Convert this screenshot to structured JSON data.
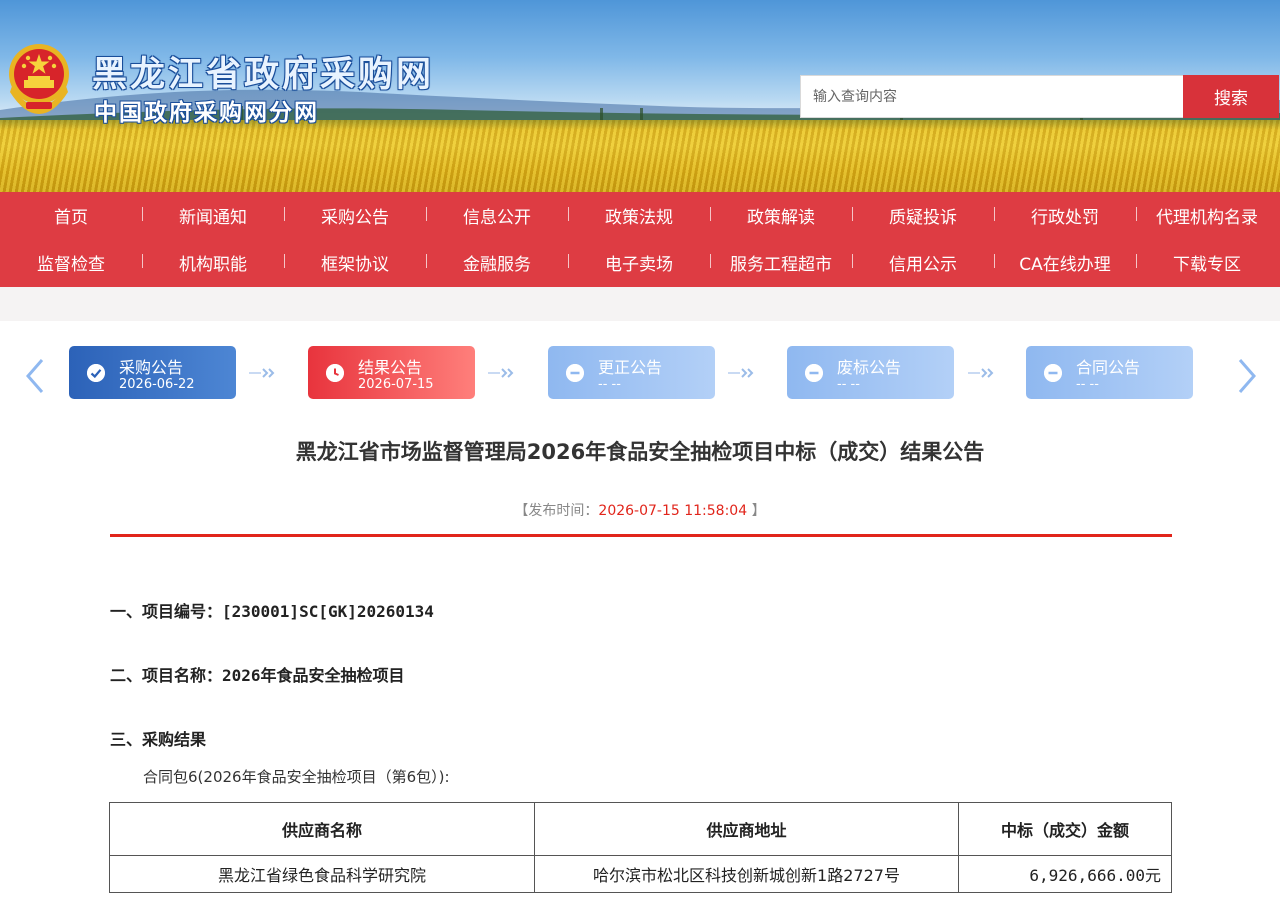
{
  "header": {
    "site_title": "黑龙江省政府采购网",
    "site_subtitle": "中国政府采购网分网",
    "search_placeholder": "输入查询内容",
    "search_button": "搜索"
  },
  "nav": {
    "row1": [
      "首页",
      "新闻通知",
      "采购公告",
      "信息公开",
      "政策法规",
      "政策解读",
      "质疑投诉",
      "行政处罚",
      "代理机构名录"
    ],
    "row2": [
      "监督检查",
      "机构职能",
      "框架协议",
      "金融服务",
      "电子卖场",
      "服务工程超市",
      "信用公示",
      "CA在线办理",
      "下载专区"
    ]
  },
  "steps": [
    {
      "label": "采购公告",
      "date": "2026-06-22",
      "icon": "check-icon",
      "state": "done"
    },
    {
      "label": "结果公告",
      "date": "2026-07-15",
      "icon": "clock-icon",
      "state": "current"
    },
    {
      "label": "更正公告",
      "date": "-- --",
      "icon": "minus-icon",
      "state": "none"
    },
    {
      "label": "废标公告",
      "date": "-- --",
      "icon": "minus-icon",
      "state": "none"
    },
    {
      "label": "合同公告",
      "date": "-- --",
      "icon": "minus-icon",
      "state": "none"
    }
  ],
  "article": {
    "title": "黑龙江省市场监督管理局2026年食品安全抽检项目中标（成交）结果公告",
    "pub_prefix": "【发布时间：",
    "pub_time": "2026-07-15 11:58:04",
    "pub_suffix": "】",
    "section1": "一、项目编号：[230001]SC[GK]20260134",
    "section2": "二、项目名称：2026年食品安全抽检项目",
    "section3": "三、采购结果",
    "package": "合同包6(2026年食品安全抽检项目（第6包）):",
    "table": {
      "headers": [
        "供应商名称",
        "供应商地址",
        "中标（成交）金额"
      ],
      "rows": [
        [
          "黑龙江省绿色食品科学研究院",
          "哈尔滨市松北区科技创新城创新1路2727号",
          "6,926,666.00元"
        ]
      ]
    }
  },
  "colors": {
    "nav_red": "#de3c43",
    "step_blue": "#2c62b8",
    "step_red": "#e8343d",
    "step_light": "#8fb8f0",
    "rule_red": "#e1251b"
  }
}
